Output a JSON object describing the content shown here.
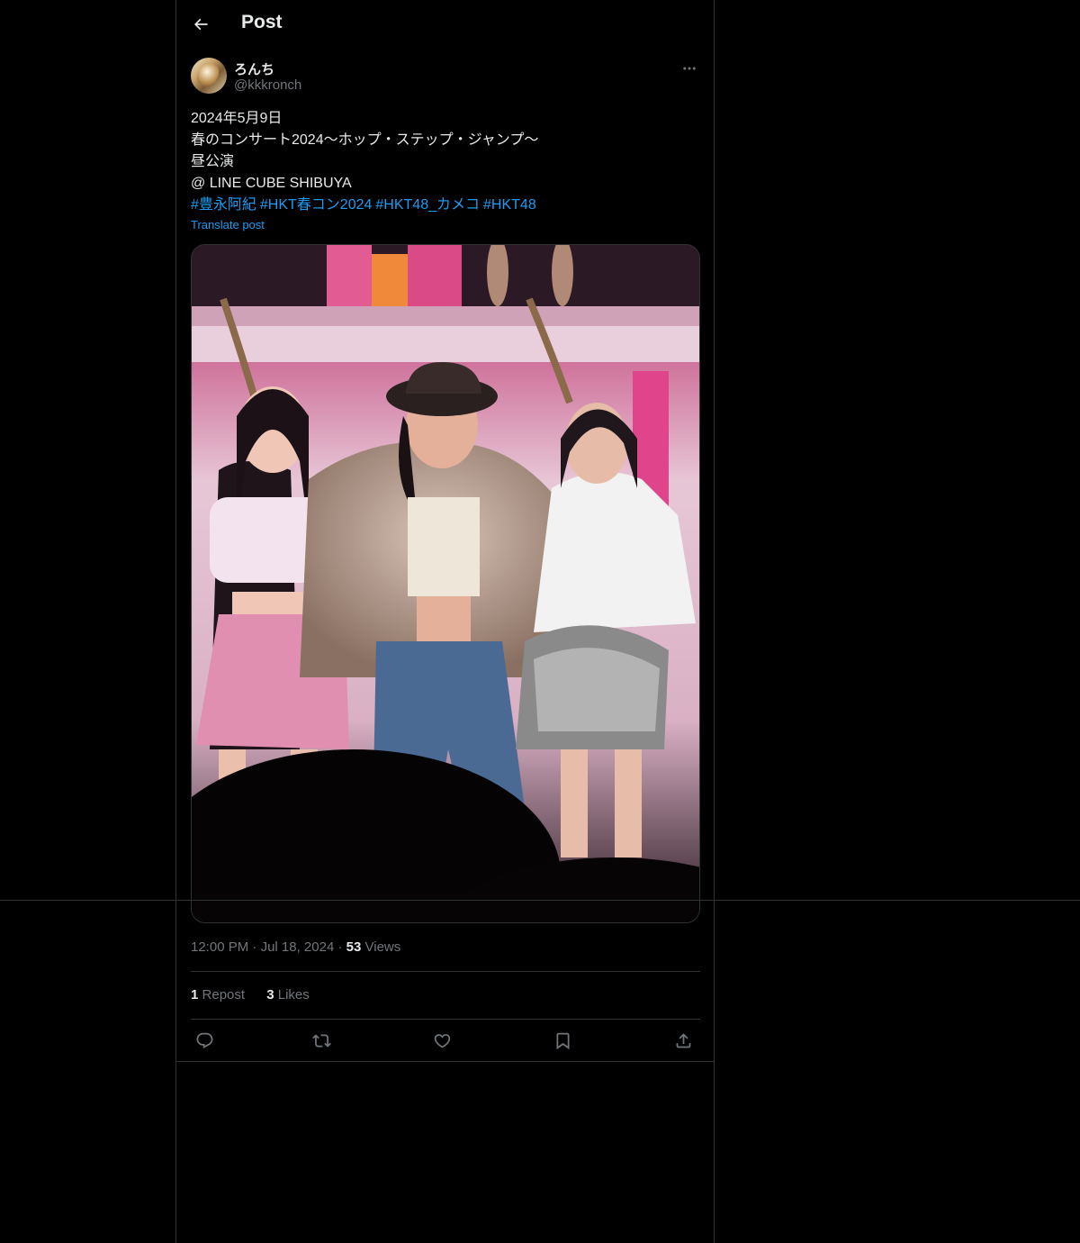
{
  "header": {
    "title": "Post"
  },
  "author": {
    "display_name": "ろんち",
    "handle": "@kkkronch"
  },
  "post": {
    "lines": [
      "2024年5月9日",
      "春のコンサート2024〜ホップ・ステップ・ジャンプ〜",
      "昼公演",
      "@ LINE CUBE SHIBUYA"
    ],
    "hashtags": [
      "#豊永阿紀",
      "#HKT春コン2024",
      "#HKT48_カメコ",
      "#HKT48"
    ],
    "translate_label": "Translate post"
  },
  "meta": {
    "time": "12:00 PM",
    "separator": "·",
    "date": "Jul 18, 2024",
    "views_count": "53",
    "views_label": "Views"
  },
  "stats": {
    "reposts_count": "1",
    "reposts_label": "Repost",
    "likes_count": "3",
    "likes_label": "Likes"
  },
  "icons": {
    "back": "back-arrow-icon",
    "more": "more-icon",
    "reply": "reply-icon",
    "repost": "repost-icon",
    "like": "heart-icon",
    "bookmark": "bookmark-icon",
    "share": "share-icon"
  },
  "colors": {
    "link": "#1d9bf0",
    "muted": "#71767b",
    "text": "#e7e9ea",
    "border": "#2f3336",
    "background": "#000000"
  }
}
